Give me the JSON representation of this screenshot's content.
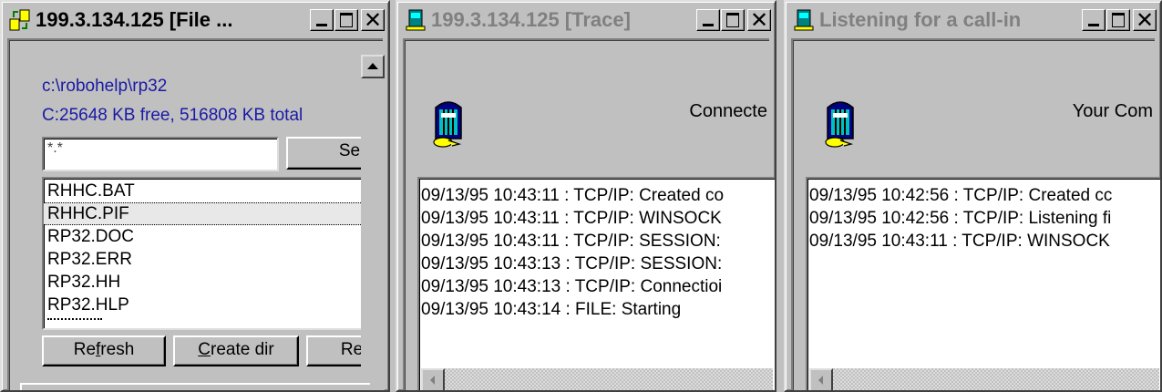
{
  "file_window": {
    "title": "199.3.134.125 [File ...",
    "path": "c:\\robohelp\\rp32",
    "disk_info": "C:25648 KB free, 516808 KB total",
    "filter_value": "*.*",
    "search_button": "Sear",
    "files": [
      "RHHC.BAT",
      "RHHC.PIF",
      "RP32.DOC",
      "RP32.ERR",
      "RP32.HH",
      "RP32.HLP"
    ],
    "selected_file": "RHHC.PIF",
    "refresh_pre": "Re",
    "refresh_u": "f",
    "refresh_post": "resh",
    "createdir_u": "C",
    "createdir_post": "reate dir",
    "remove_button": "Rem",
    "path_color": "#1a1aa6"
  },
  "trace_window": {
    "title": "199.3.134.125 [Trace]",
    "status": "Connecte",
    "log": [
      "09/13/95 10:43:11 : TCP/IP: Created co",
      "09/13/95 10:43:11 : TCP/IP: WINSOCK",
      "09/13/95 10:43:11 : TCP/IP: SESSION:",
      "09/13/95 10:43:13 : TCP/IP: SESSION:",
      "09/13/95 10:43:13 : TCP/IP: Connectioi",
      "09/13/95 10:43:14 : FILE: Starting"
    ]
  },
  "listen_window": {
    "title": "Listening for a call-in",
    "status": "Your Com",
    "log": [
      "09/13/95 10:42:56 : TCP/IP: Created cc",
      "09/13/95 10:42:56 : TCP/IP: Listening fi",
      "09/13/95 10:43:11 : TCP/IP: WINSOCK"
    ]
  },
  "icons": [
    "file-transfer-icon",
    "modem-phone-icon",
    "remote-connect-icon",
    "minimize-icon",
    "maximize-icon",
    "close-icon",
    "scroll-up-arrow-icon",
    "scroll-left-arrow-icon"
  ]
}
